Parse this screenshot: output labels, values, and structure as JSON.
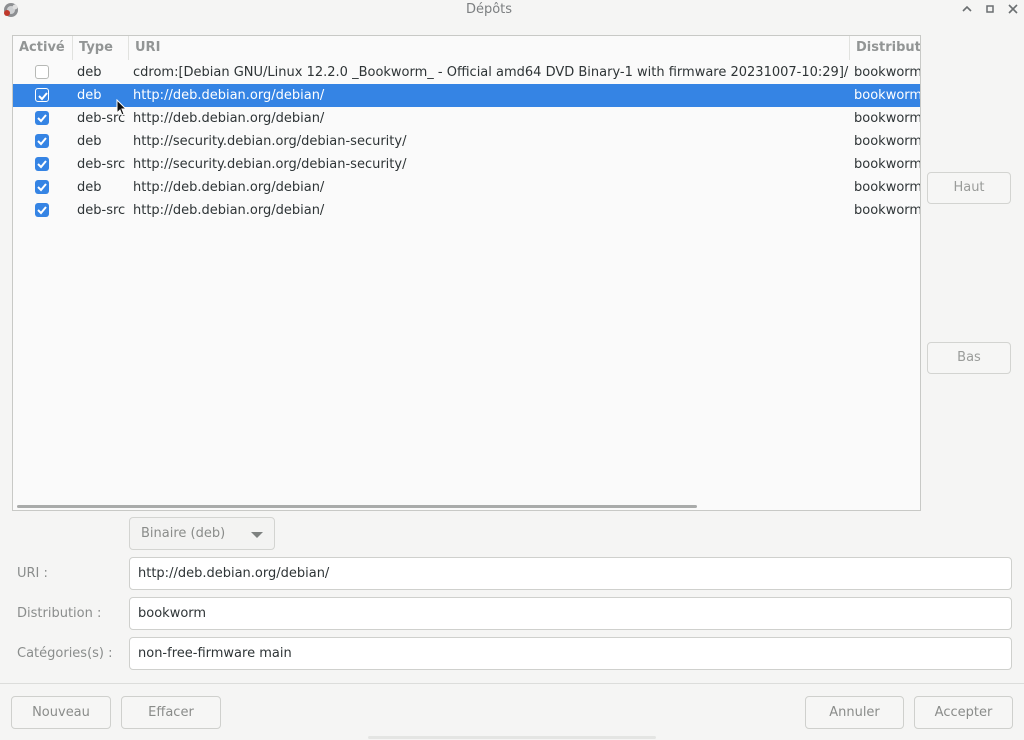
{
  "window": {
    "title": "Dépôts"
  },
  "table": {
    "columns": [
      "Activé",
      "Type",
      "URI",
      "Distribution"
    ],
    "rows": [
      {
        "enabled": false,
        "type": "deb",
        "uri": "cdrom:[Debian GNU/Linux 12.2.0 _Bookworm_ - Official amd64 DVD Binary-1 with firmware 20231007-10:29]/",
        "distribution": "bookworm",
        "selected": false
      },
      {
        "enabled": true,
        "type": "deb",
        "uri": "http://deb.debian.org/debian/",
        "distribution": "bookworm",
        "selected": true
      },
      {
        "enabled": true,
        "type": "deb-src",
        "uri": "http://deb.debian.org/debian/",
        "distribution": "bookworm",
        "selected": false
      },
      {
        "enabled": true,
        "type": "deb",
        "uri": "http://security.debian.org/debian-security/",
        "distribution": "bookworm",
        "selected": false
      },
      {
        "enabled": true,
        "type": "deb-src",
        "uri": "http://security.debian.org/debian-security/",
        "distribution": "bookworm",
        "selected": false
      },
      {
        "enabled": true,
        "type": "deb",
        "uri": "http://deb.debian.org/debian/",
        "distribution": "bookworm",
        "selected": false
      },
      {
        "enabled": true,
        "type": "deb-src",
        "uri": "http://deb.debian.org/debian/",
        "distribution": "bookworm",
        "selected": false
      }
    ]
  },
  "side_buttons": {
    "up": "Haut",
    "down": "Bas"
  },
  "form": {
    "type_select": "Binaire (deb)",
    "uri_label": "URI :",
    "uri_value": "http://deb.debian.org/debian/",
    "dist_label": "Distribution :",
    "dist_value": "bookworm",
    "cat_label": "Catégories(s) :",
    "cat_value": "non-free-firmware main"
  },
  "buttons": {
    "new": "Nouveau",
    "delete": "Effacer",
    "cancel": "Annuler",
    "accept": "Accepter"
  },
  "colors": {
    "selection": "#3584e4",
    "check": "#3584e4"
  }
}
